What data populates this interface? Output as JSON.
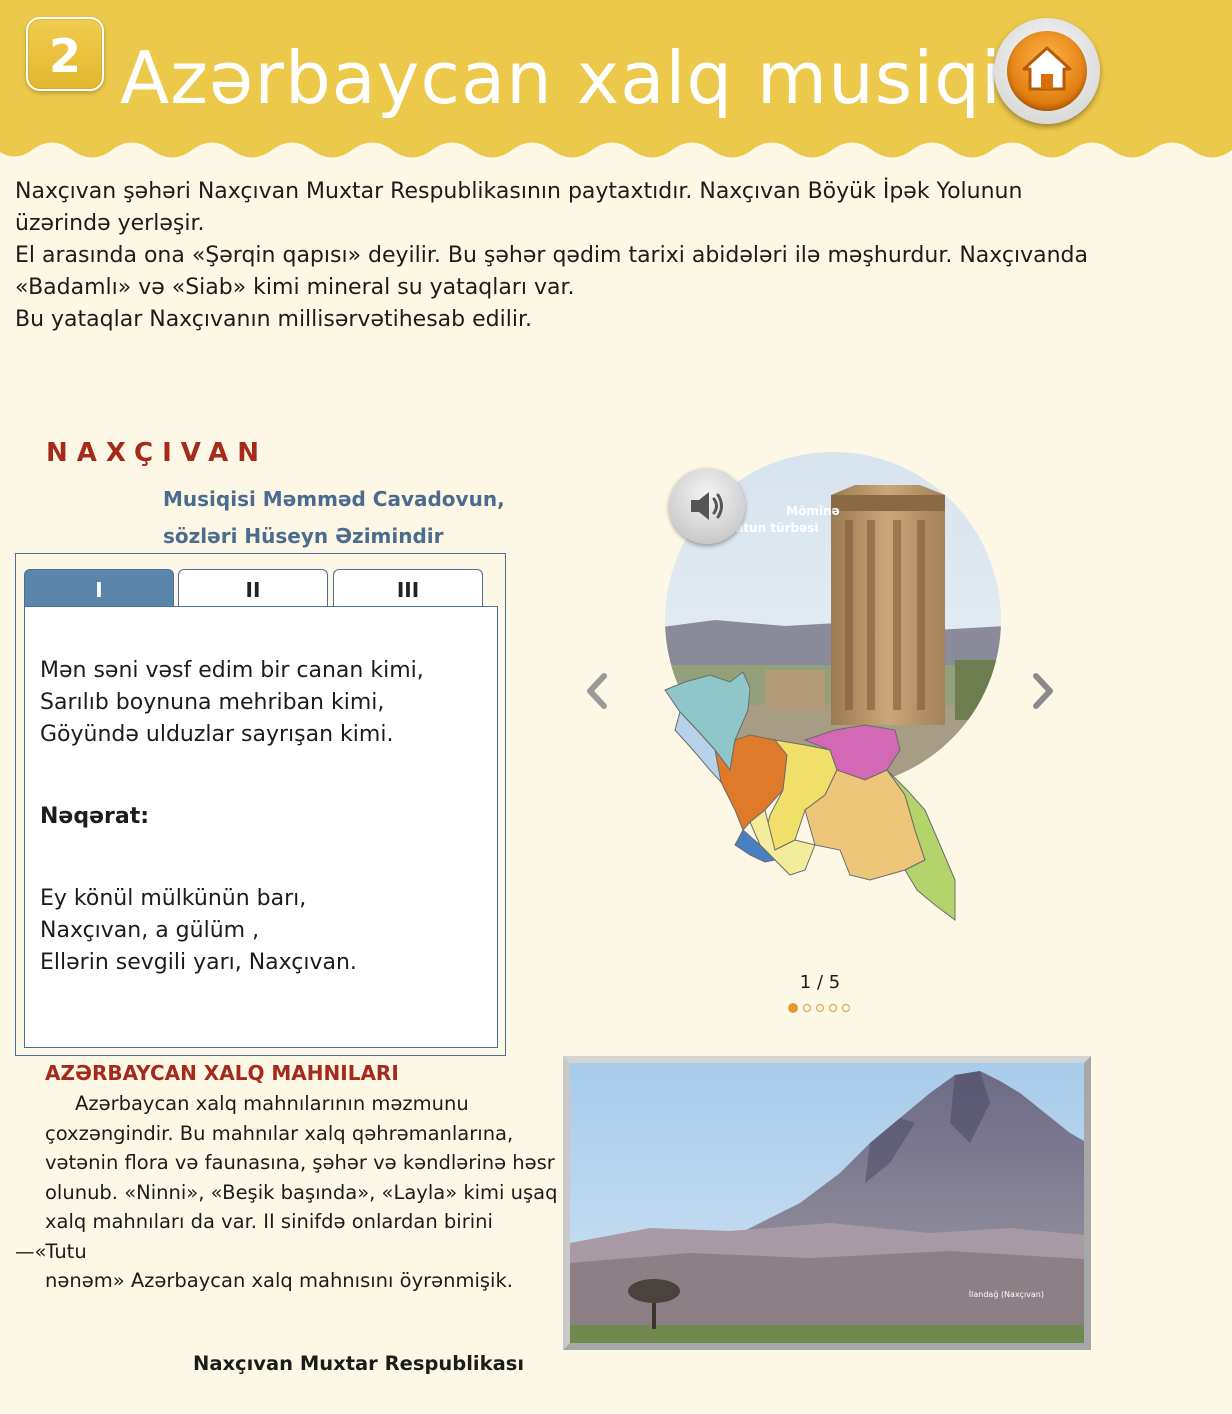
{
  "header": {
    "lesson_number": "2",
    "title": "Azərbaycan xalq musiqisi",
    "home_icon": "home-icon"
  },
  "intro": {
    "paragraphs": [
      "Naxçıvan şəhəri Naxçıvan Muxtar Respublikasının paytaxtıdır. Naxçıvan Böyük İpək Yolunun",
      "üzərində yerləşir.",
      "El arasında ona «Şərqin qapısı» deyilir. Bu şəhər qədim tarixi abidələri ilə məşhurdur. Naxçıvanda",
      "«Badamlı» və «Siab» kimi mineral su yataqları var.",
      "Bu yataqlar Naxçıvanın millisərvətihesab edilir."
    ]
  },
  "song": {
    "title": "NAXÇIVAN",
    "credit_line1": "Musiqisi Məmməd Cavadovun,",
    "credit_line2": "sözləri Hüseyn Əzimindir",
    "tabs": [
      "I",
      "II",
      "III"
    ],
    "active_tab": 0,
    "verse_lines": [
      "Mən səni vəsf edim bir canan kimi,",
      "Sarılıb boynuna mehriban kimi,",
      "Göyündə ulduzlar sayrışan kimi."
    ],
    "refrain_label": "Nəqərat:",
    "refrain_lines": [
      "Ey könül mülkünün barı,",
      "Naxçıvan, a gülüm ,",
      "Ellərin sevgili yarı, Naxçıvan."
    ]
  },
  "folk_songs": {
    "title": "AZƏRBAYCAN XALQ MAHNILARI",
    "lines": [
      "Azərbaycan xalq mahnılarının məzmunu",
      "çoxzəngindir. Bu mahnılar xalq qəhrəmanlarına,",
      "vətənin flora və faunasına, şəhər və kəndlərinə həsr",
      "olunub. «Ninni», «Beşik başında», «Layla» kimi uşaq",
      "xalq mahnıları da var. II sinifdə onlardan birini",
      "—«Tutu",
      "nənəm» Azərbaycan xalq mahnısını öyrənmişik."
    ],
    "caption": "Naxçıvan Muxtar Respublikası"
  },
  "slider": {
    "counter": "1 / 5",
    "current": 1,
    "total": 5,
    "slide_label": "Möminə xatun türbəsi",
    "slide_label_line1": "Möminə",
    "slide_label_line2": "xatun türbəsi",
    "sound_icon": "speaker-icon",
    "prev_icon": "chevron-left-icon",
    "next_icon": "chevron-right-icon"
  },
  "photo": {
    "label": "İlandağ (Naxçıvan)"
  },
  "colors": {
    "header_yellow": "#ecc94a",
    "background": "#fdf8e6",
    "title_red": "#a52a1c",
    "credit_blue": "#4b6b8f",
    "tab_active": "#5b86ab",
    "dot_orange": "#e89a32"
  }
}
